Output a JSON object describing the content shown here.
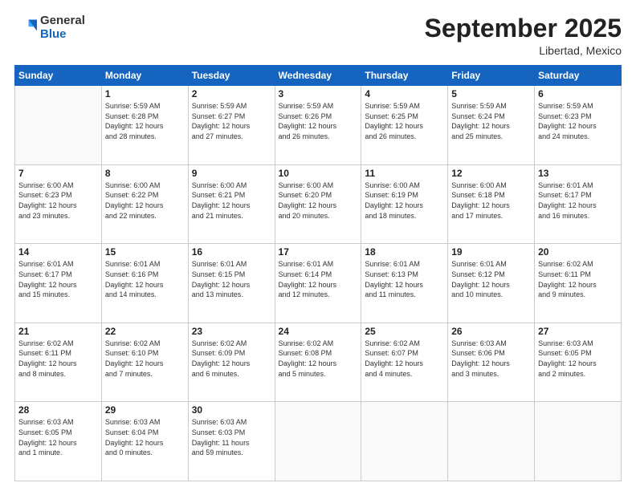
{
  "header": {
    "logo_general": "General",
    "logo_blue": "Blue",
    "month_title": "September 2025",
    "location": "Libertad, Mexico"
  },
  "days_of_week": [
    "Sunday",
    "Monday",
    "Tuesday",
    "Wednesday",
    "Thursday",
    "Friday",
    "Saturday"
  ],
  "weeks": [
    [
      {
        "day": "",
        "info": ""
      },
      {
        "day": "1",
        "info": "Sunrise: 5:59 AM\nSunset: 6:28 PM\nDaylight: 12 hours\nand 28 minutes."
      },
      {
        "day": "2",
        "info": "Sunrise: 5:59 AM\nSunset: 6:27 PM\nDaylight: 12 hours\nand 27 minutes."
      },
      {
        "day": "3",
        "info": "Sunrise: 5:59 AM\nSunset: 6:26 PM\nDaylight: 12 hours\nand 26 minutes."
      },
      {
        "day": "4",
        "info": "Sunrise: 5:59 AM\nSunset: 6:25 PM\nDaylight: 12 hours\nand 26 minutes."
      },
      {
        "day": "5",
        "info": "Sunrise: 5:59 AM\nSunset: 6:24 PM\nDaylight: 12 hours\nand 25 minutes."
      },
      {
        "day": "6",
        "info": "Sunrise: 5:59 AM\nSunset: 6:23 PM\nDaylight: 12 hours\nand 24 minutes."
      }
    ],
    [
      {
        "day": "7",
        "info": "Sunrise: 6:00 AM\nSunset: 6:23 PM\nDaylight: 12 hours\nand 23 minutes."
      },
      {
        "day": "8",
        "info": "Sunrise: 6:00 AM\nSunset: 6:22 PM\nDaylight: 12 hours\nand 22 minutes."
      },
      {
        "day": "9",
        "info": "Sunrise: 6:00 AM\nSunset: 6:21 PM\nDaylight: 12 hours\nand 21 minutes."
      },
      {
        "day": "10",
        "info": "Sunrise: 6:00 AM\nSunset: 6:20 PM\nDaylight: 12 hours\nand 20 minutes."
      },
      {
        "day": "11",
        "info": "Sunrise: 6:00 AM\nSunset: 6:19 PM\nDaylight: 12 hours\nand 18 minutes."
      },
      {
        "day": "12",
        "info": "Sunrise: 6:00 AM\nSunset: 6:18 PM\nDaylight: 12 hours\nand 17 minutes."
      },
      {
        "day": "13",
        "info": "Sunrise: 6:01 AM\nSunset: 6:17 PM\nDaylight: 12 hours\nand 16 minutes."
      }
    ],
    [
      {
        "day": "14",
        "info": "Sunrise: 6:01 AM\nSunset: 6:17 PM\nDaylight: 12 hours\nand 15 minutes."
      },
      {
        "day": "15",
        "info": "Sunrise: 6:01 AM\nSunset: 6:16 PM\nDaylight: 12 hours\nand 14 minutes."
      },
      {
        "day": "16",
        "info": "Sunrise: 6:01 AM\nSunset: 6:15 PM\nDaylight: 12 hours\nand 13 minutes."
      },
      {
        "day": "17",
        "info": "Sunrise: 6:01 AM\nSunset: 6:14 PM\nDaylight: 12 hours\nand 12 minutes."
      },
      {
        "day": "18",
        "info": "Sunrise: 6:01 AM\nSunset: 6:13 PM\nDaylight: 12 hours\nand 11 minutes."
      },
      {
        "day": "19",
        "info": "Sunrise: 6:01 AM\nSunset: 6:12 PM\nDaylight: 12 hours\nand 10 minutes."
      },
      {
        "day": "20",
        "info": "Sunrise: 6:02 AM\nSunset: 6:11 PM\nDaylight: 12 hours\nand 9 minutes."
      }
    ],
    [
      {
        "day": "21",
        "info": "Sunrise: 6:02 AM\nSunset: 6:11 PM\nDaylight: 12 hours\nand 8 minutes."
      },
      {
        "day": "22",
        "info": "Sunrise: 6:02 AM\nSunset: 6:10 PM\nDaylight: 12 hours\nand 7 minutes."
      },
      {
        "day": "23",
        "info": "Sunrise: 6:02 AM\nSunset: 6:09 PM\nDaylight: 12 hours\nand 6 minutes."
      },
      {
        "day": "24",
        "info": "Sunrise: 6:02 AM\nSunset: 6:08 PM\nDaylight: 12 hours\nand 5 minutes."
      },
      {
        "day": "25",
        "info": "Sunrise: 6:02 AM\nSunset: 6:07 PM\nDaylight: 12 hours\nand 4 minutes."
      },
      {
        "day": "26",
        "info": "Sunrise: 6:03 AM\nSunset: 6:06 PM\nDaylight: 12 hours\nand 3 minutes."
      },
      {
        "day": "27",
        "info": "Sunrise: 6:03 AM\nSunset: 6:05 PM\nDaylight: 12 hours\nand 2 minutes."
      }
    ],
    [
      {
        "day": "28",
        "info": "Sunrise: 6:03 AM\nSunset: 6:05 PM\nDaylight: 12 hours\nand 1 minute."
      },
      {
        "day": "29",
        "info": "Sunrise: 6:03 AM\nSunset: 6:04 PM\nDaylight: 12 hours\nand 0 minutes."
      },
      {
        "day": "30",
        "info": "Sunrise: 6:03 AM\nSunset: 6:03 PM\nDaylight: 11 hours\nand 59 minutes."
      },
      {
        "day": "",
        "info": ""
      },
      {
        "day": "",
        "info": ""
      },
      {
        "day": "",
        "info": ""
      },
      {
        "day": "",
        "info": ""
      }
    ]
  ]
}
